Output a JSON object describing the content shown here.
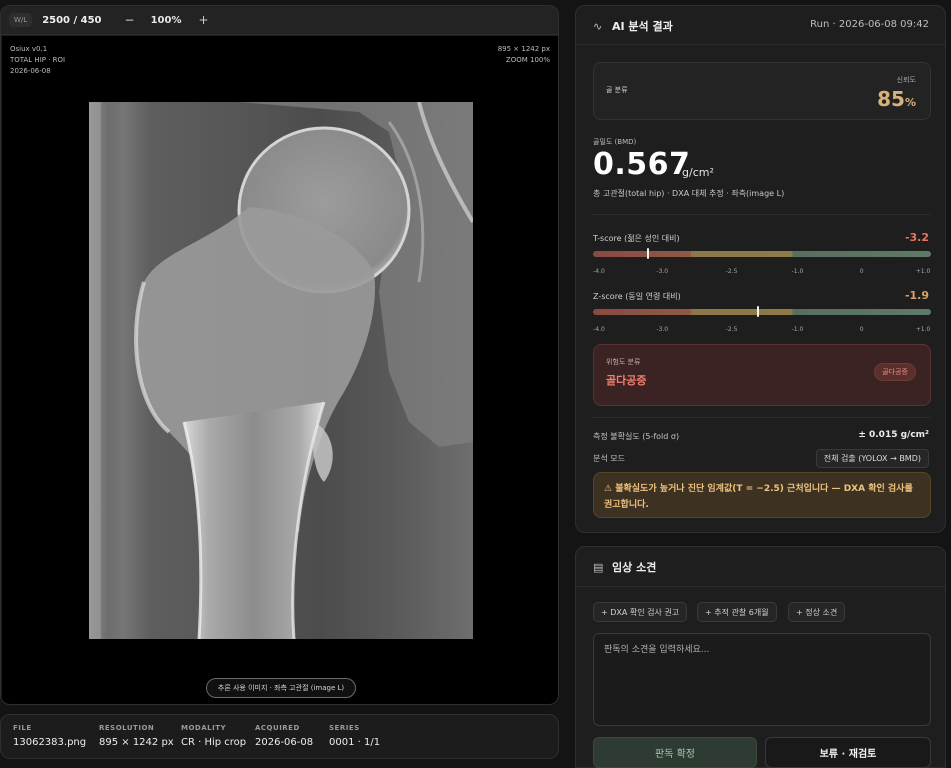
{
  "viewer": {
    "wl_label": "W/L",
    "wl_value": "2500 / 450",
    "zoom_out": "−",
    "zoom": "100%",
    "zoom_in": "+",
    "overlay_tl": [
      "Osiux v0.1",
      "TOTAL HIP · ROI",
      "2026-06-08"
    ],
    "overlay_tr": [
      "895 × 1242 px",
      "ZOOM 100%"
    ],
    "caption": "추론 사용 이미지 · 좌측 고관절 (image L)"
  },
  "meta": {
    "file_label": "FILE",
    "file": "13062383.png",
    "res_label": "RESOLUTION",
    "res": "895 × 1242 px",
    "mod_label": "MODALITY",
    "mod": "CR · Hip crop",
    "acq_label": "ACQUIRED",
    "acq": "2026-06-08",
    "series_label": "SERIES",
    "series": "0001 · 1/1"
  },
  "ai": {
    "title": "AI 분석 결과",
    "run": "Run · 2026-06-08 09:42",
    "class_label": "골 분류",
    "confidence_label": "신뢰도",
    "confidence_value": "85",
    "confidence_unit": "%",
    "bmd_label": "골밀도 (BMD)",
    "bmd_value": "0.567",
    "bmd_unit": "g/cm²",
    "bmd_sub": "총 고관절(total hip) · DXA 대체 추정 · 좌측(image L)",
    "t_label": "T-score (젊은 성인 대비)",
    "t_value": "-3.2",
    "t_score": -3.2,
    "z_label": "Z-score (동일 연령 대비)",
    "z_value": "-1.9",
    "z_score": -1.9,
    "scale_ticks": [
      "-4.0",
      "-3.0",
      "-2.5",
      "-1.0",
      "0",
      "+1.0"
    ],
    "risk_label": "위험도 분류",
    "risk_value": "골다공증",
    "risk_badge": "골다공증",
    "uncert_label": "측정 불확실도 (5-fold σ)",
    "uncert_value": "± 0.015 g/cm²",
    "mode_label": "분석 모드",
    "mode_value": "전체 검출 (YOLOX → BMD)",
    "warning": "⚠ 불확실도가 높거나 진단 임계값(T = −2.5) 근처입니다 — DXA 확인 검사를 권고합니다."
  },
  "notes": {
    "title": "임상 소견",
    "quick": [
      "+ DXA 확인 검사 권고",
      "+ 추적 관찰 6개월",
      "+ 정상 소견"
    ],
    "placeholder": "판독의 소견을 입력하세요...",
    "confirm": "판독 확정",
    "hold": "보류 · 재검토"
  },
  "colors": {
    "accent_red": "#e7765f",
    "confidence": "#d9b27a",
    "warning": "#f0c27e"
  }
}
